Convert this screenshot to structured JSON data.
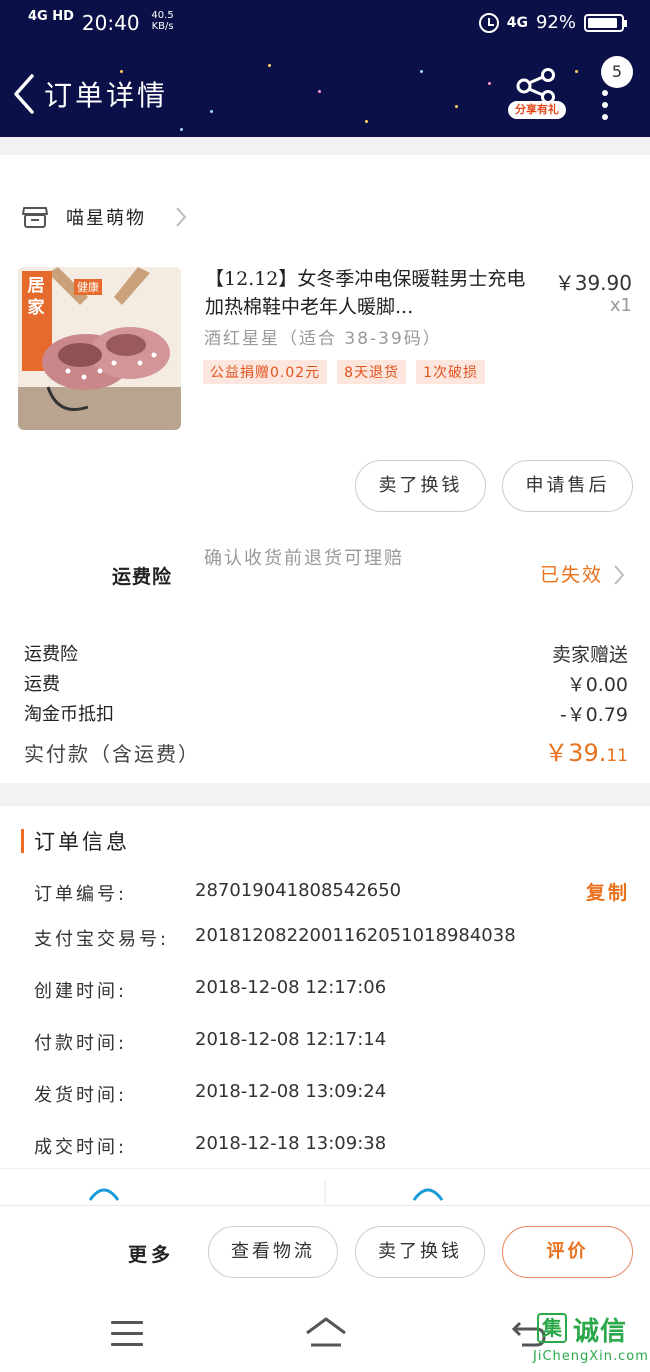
{
  "status_bar": {
    "signal_left": "4G HD",
    "time": "20:40",
    "net_rate": "40.5",
    "net_rate_unit": "KB/s",
    "signal_right": "4G",
    "battery_percent": "92%",
    "battery_level": 0.92
  },
  "navbar": {
    "title": "订单详情",
    "share_badge": "分享有礼",
    "message_count": "5"
  },
  "shop": {
    "name": "喵星萌物"
  },
  "product": {
    "title": "【12.12】女冬季冲电保暖鞋男士充电加热棉鞋中老年人暖脚...",
    "price": "￥39.90",
    "quantity": "x1",
    "sku": "酒红星星（适合 38-39码）",
    "tags": [
      "公益捐赠0.02元",
      "8天退货",
      "1次破损"
    ],
    "image_label_main": "居家",
    "image_label_sub": "健康"
  },
  "buttons": {
    "sell": "卖了换钱",
    "after_sale": "申请售后",
    "more": "更多",
    "track": "查看物流",
    "sell_bottom": "卖了换钱",
    "rate": "评价"
  },
  "insurance": {
    "label": "运费险",
    "desc": "确认收货前退货可理赔",
    "status": "已失效"
  },
  "fees": [
    {
      "label": "运费险",
      "value": "卖家赠送"
    },
    {
      "label": "运费",
      "value": "￥0.00"
    },
    {
      "label": "淘金币抵扣",
      "value": "-￥0.79"
    }
  ],
  "total": {
    "label": "实付款（含运费）",
    "value_main": "￥39.",
    "value_cents": "11"
  },
  "order_info": {
    "title": "订单信息",
    "copy_label": "复制",
    "rows": [
      {
        "key": "订单编号:",
        "value": "287019041808542650"
      },
      {
        "key": "支付宝交易号:",
        "value": "2018120822001162051018984038"
      },
      {
        "key": "创建时间:",
        "value": "2018-12-08 12:17:06"
      },
      {
        "key": "付款时间:",
        "value": "2018-12-08 12:17:14"
      },
      {
        "key": "发货时间:",
        "value": "2018-12-08 13:09:24"
      },
      {
        "key": "成交时间:",
        "value": "2018-12-18 13:09:38"
      }
    ]
  },
  "watermark": {
    "text": "诚信",
    "url": "JiChengXin.com",
    "box": "集"
  },
  "colors": {
    "header_bg": "#0b1148",
    "accent": "#e8721d",
    "tag_bg": "#fde6de"
  }
}
